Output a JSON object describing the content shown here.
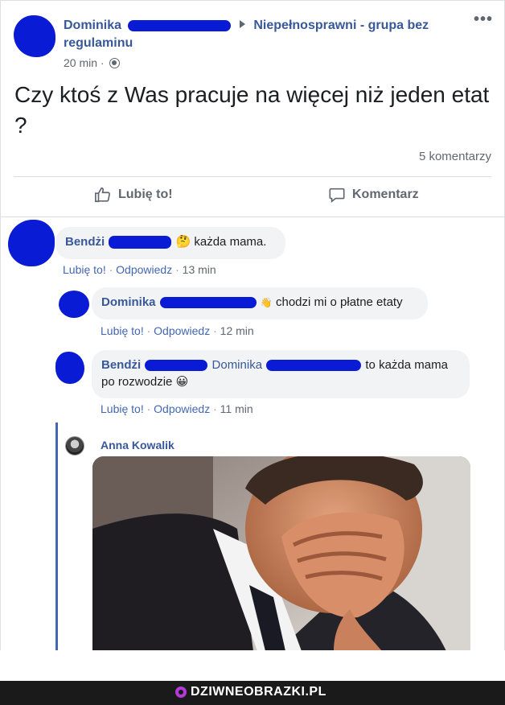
{
  "post": {
    "author": "Dominika",
    "group_arrow": "▶",
    "group": "Niepełnosprawni - grupa bez regulaminu",
    "time": "20 min",
    "meta_sep": "·",
    "text": "Czy ktoś z Was pracuje na więcej niż jeden etat ?",
    "comment_count": "5 komentarzy",
    "like_label": "Lubię to!",
    "comment_label": "Komentarz",
    "more": "•••"
  },
  "comments": [
    {
      "author": "Bendżi",
      "emoji": "🤔",
      "text": "każda mama.",
      "like": "Lubię to!",
      "reply": "Odpowiedz",
      "time": "13 min"
    },
    {
      "author": "Dominika",
      "emoji": "👋",
      "text": "chodzi mi o płatne etaty",
      "like": "Lubię to!",
      "reply": "Odpowiedz",
      "time": "12 min"
    },
    {
      "author": "Bendżi",
      "mention": "Dominika",
      "text": "to każda mama po rozwodzie",
      "emoji": "😀",
      "like": "Lubię to!",
      "reply": "Odpowiedz",
      "time": "11 min"
    },
    {
      "author": "Anna Kowalik"
    }
  ],
  "footer": {
    "brand": "DZIWNEOBRAZKI.PL"
  },
  "colors": {
    "link": "#385898",
    "redaction": "#0a1bd6",
    "bubble": "#f2f3f5"
  }
}
